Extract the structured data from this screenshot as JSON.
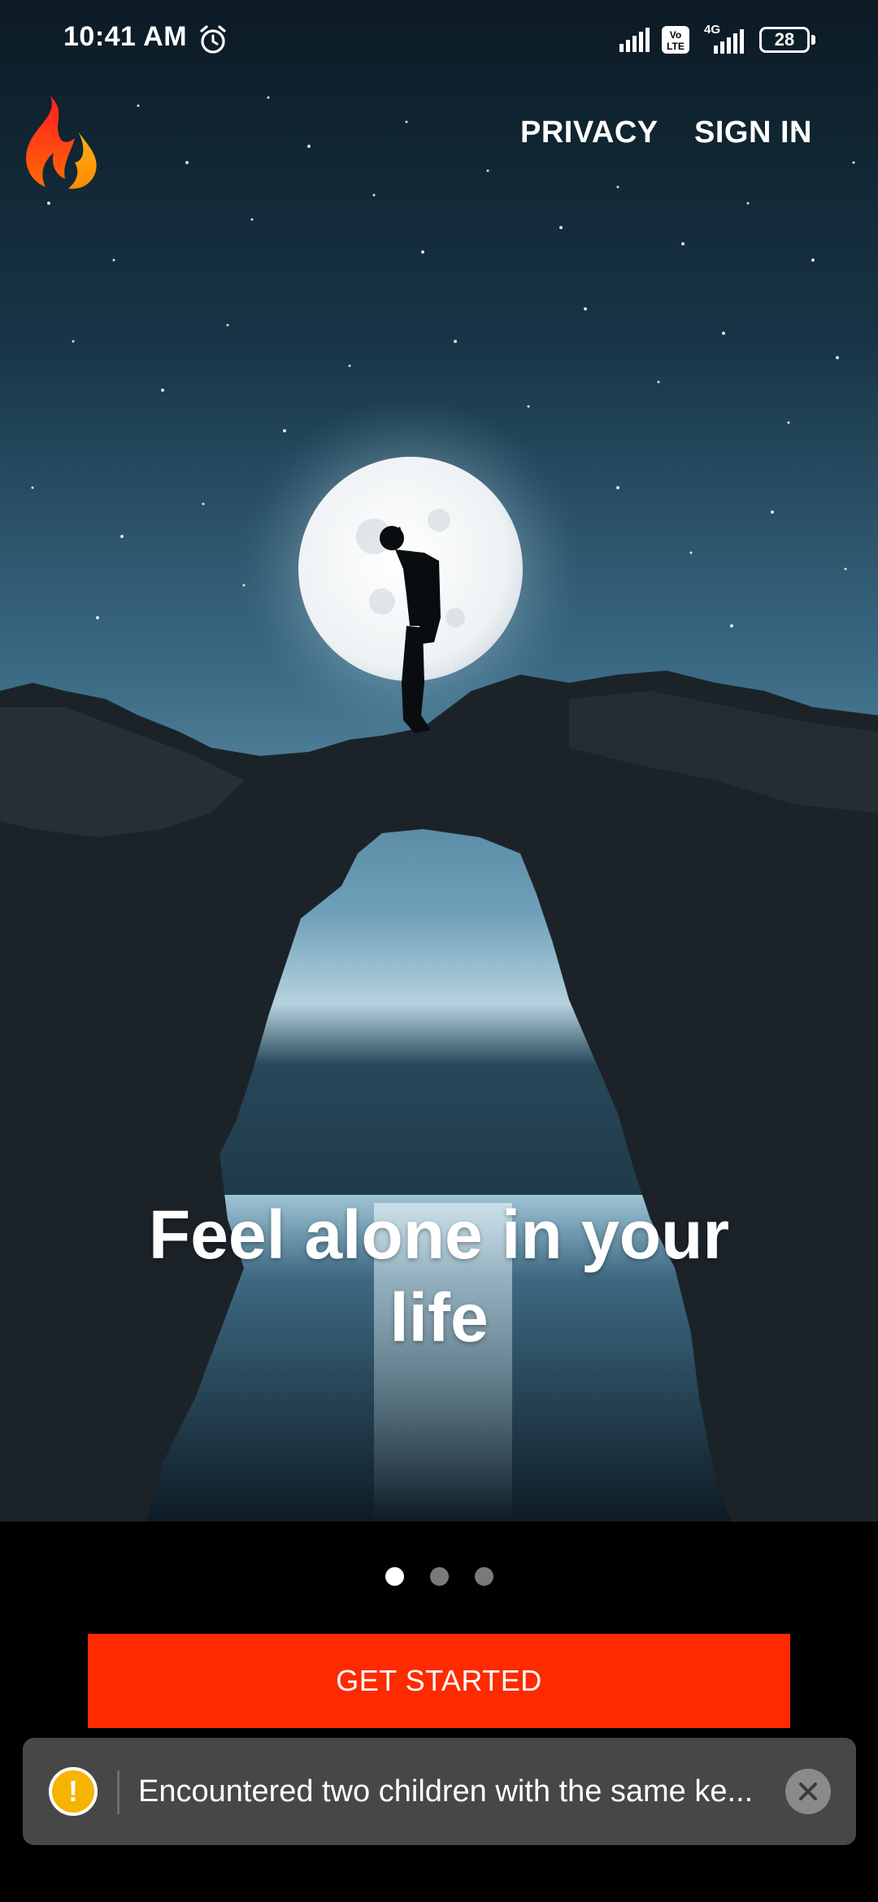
{
  "status_bar": {
    "time": "10:41 AM",
    "icons": [
      "alarm-icon",
      "signal-icon",
      "volte-icon",
      "4g-signal-icon",
      "battery-icon"
    ],
    "network_label": "4G",
    "volte_label": "Vo LTE",
    "battery_level": "28"
  },
  "nav": {
    "logo": "flame-logo",
    "privacy_label": "PRIVACY",
    "signin_label": "SIGN IN"
  },
  "hero": {
    "image": "man-on-rock-arch-under-full-moon",
    "caption": "Feel alone in your life"
  },
  "pager": {
    "count": 3,
    "active_index": 0
  },
  "cta": {
    "label": "GET STARTED",
    "color": "#ff2a00"
  },
  "toast": {
    "icon": "warning-icon",
    "icon_glyph": "!",
    "message": "Encountered two children with the same ke...",
    "close_icon": "close-icon"
  }
}
